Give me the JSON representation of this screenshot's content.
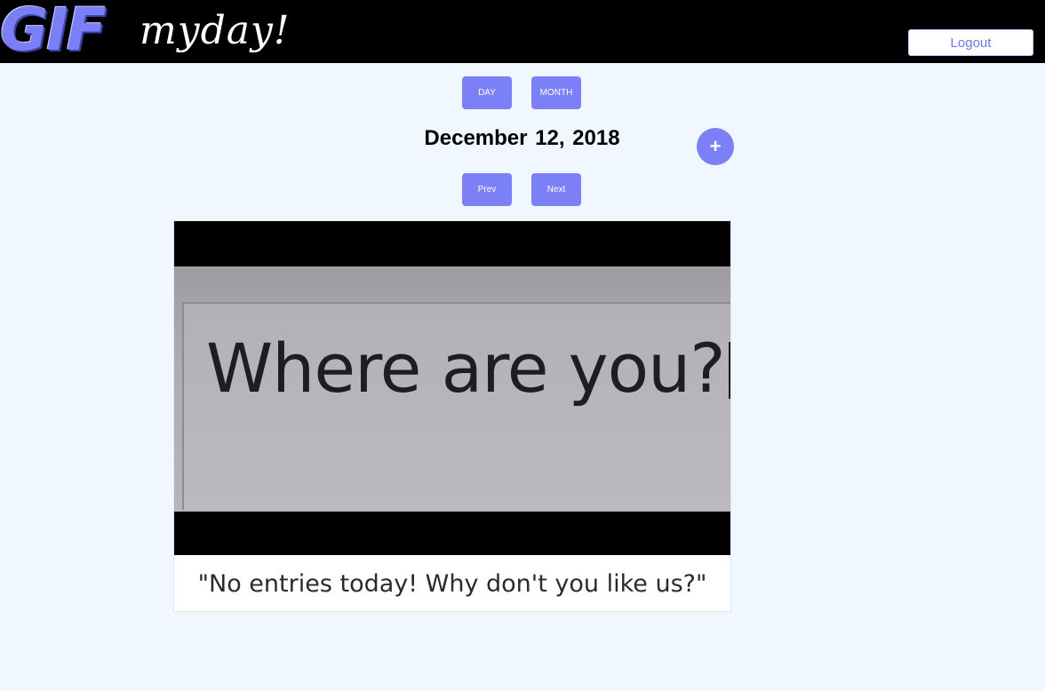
{
  "header": {
    "logo_gif": "GIF",
    "logo_script": "myday!",
    "logout_label": "Logout"
  },
  "view_toggle": {
    "day_label": "DAY",
    "month_label": "MONTH"
  },
  "date_title": "December 12, 2018",
  "add_button_label": "+",
  "pager": {
    "prev_label": "Prev",
    "next_label": "Next"
  },
  "entry": {
    "gif_text": "Where are you?",
    "caption": "\"No entries today! Why don't you like us?\""
  },
  "colors": {
    "accent": "#7c80f7",
    "background": "#f1f7fe",
    "header": "#000000"
  }
}
